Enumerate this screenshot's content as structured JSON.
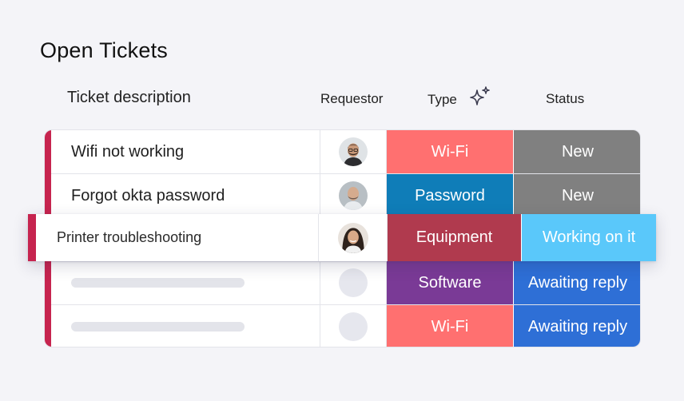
{
  "page": {
    "title": "Open Tickets"
  },
  "columns": {
    "description": "Ticket description",
    "requestor": "Requestor",
    "type": "Type",
    "status": "Status",
    "type_icon": "sparkle-icon"
  },
  "colors": {
    "group_bar": "#c6244f",
    "type_wifi": "#ff7070",
    "type_password": "#0f7db8",
    "type_equipment": "#b03a4e",
    "type_software": "#7a3a96",
    "status_new": "#808080",
    "status_working": "#5ac8fa",
    "status_awaiting": "#2e6fd6"
  },
  "tickets": [
    {
      "description": "Wifi not working",
      "requestor": "avatar-man-beard",
      "type": "Wi-Fi",
      "status": "New"
    },
    {
      "description": "Forgot okta password",
      "requestor": "avatar-man-bald",
      "type": "Password",
      "status": "New"
    },
    {
      "description": "Printer troubleshooting",
      "requestor": "avatar-woman",
      "type": "Equipment",
      "status": "Working on it"
    },
    {
      "description": "",
      "requestor": "avatar-placeholder",
      "type": "Software",
      "status": "Awaiting reply"
    },
    {
      "description": "",
      "requestor": "avatar-placeholder",
      "type": "Wi-Fi",
      "status": "Awaiting reply"
    }
  ]
}
